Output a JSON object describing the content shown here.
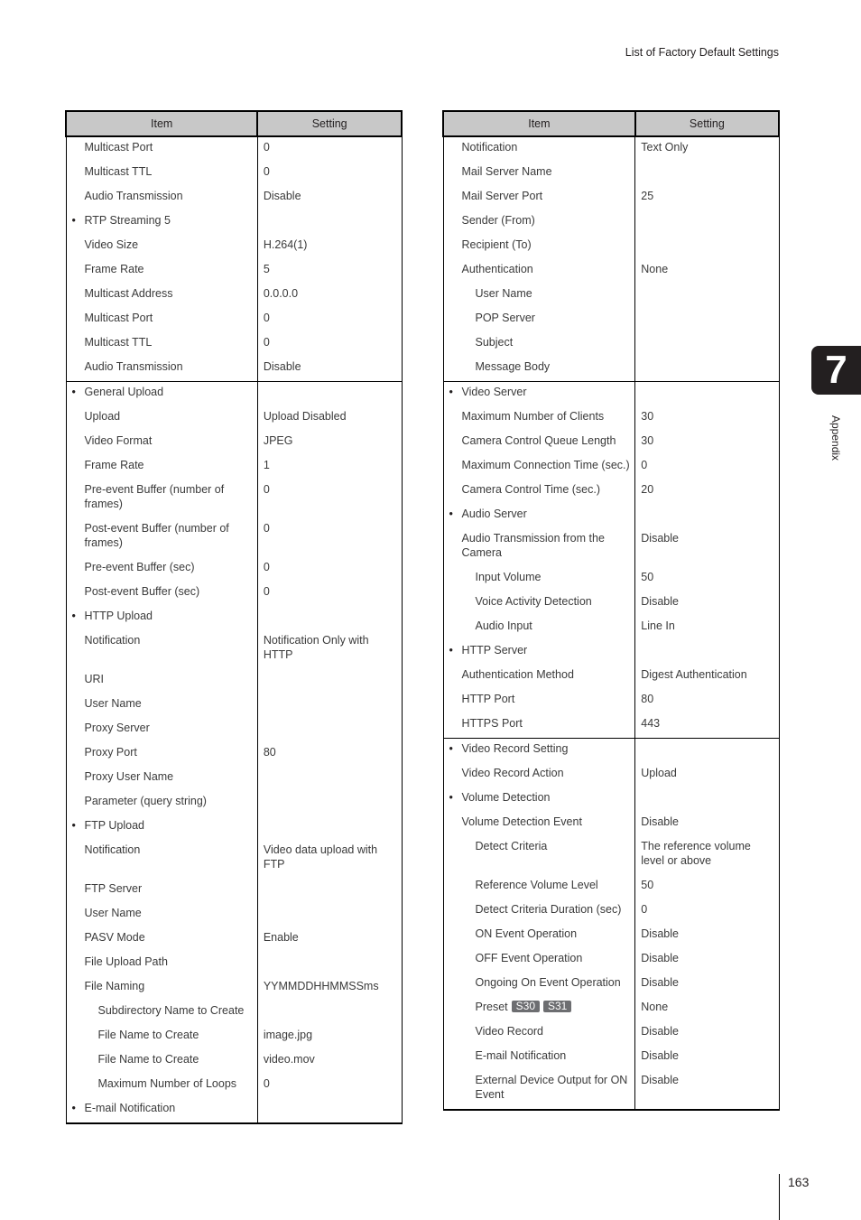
{
  "running_head": "List of Factory Default Settings",
  "chapter": {
    "number": "7",
    "label": "Appendix"
  },
  "page_number": "163",
  "headers": {
    "item": "Item",
    "setting": "Setting"
  },
  "left_table": {
    "groups": [
      {
        "rows": [
          {
            "item": "Multicast Port",
            "setting": "0",
            "level": 1
          },
          {
            "item": "Multicast TTL",
            "setting": "0",
            "level": 1
          },
          {
            "item": "Audio Transmission",
            "setting": "Disable",
            "level": 1
          },
          {
            "item": "RTP Streaming 5",
            "setting": "",
            "level": 0,
            "bullet": true
          },
          {
            "item": "Video Size",
            "setting": "H.264(1)",
            "level": 1
          },
          {
            "item": "Frame Rate",
            "setting": "5",
            "level": 1
          },
          {
            "item": "Multicast Address",
            "setting": "0.0.0.0",
            "level": 1
          },
          {
            "item": "Multicast Port",
            "setting": "0",
            "level": 1
          },
          {
            "item": "Multicast TTL",
            "setting": "0",
            "level": 1
          },
          {
            "item": "Audio Transmission",
            "setting": "Disable",
            "level": 1
          }
        ]
      },
      {
        "rows": [
          {
            "item": "General Upload",
            "setting": "",
            "level": 0,
            "bullet": true
          },
          {
            "item": "Upload",
            "setting": "Upload Disabled",
            "level": 1
          },
          {
            "item": "Video Format",
            "setting": "JPEG",
            "level": 1
          },
          {
            "item": "Frame Rate",
            "setting": "1",
            "level": 1
          },
          {
            "item": "Pre-event Buffer (number of frames)",
            "setting": "0",
            "level": 1
          },
          {
            "item": "Post-event Buffer (number of frames)",
            "setting": "0",
            "level": 1
          },
          {
            "item": "Pre-event Buffer (sec)",
            "setting": "0",
            "level": 1
          },
          {
            "item": "Post-event Buffer (sec)",
            "setting": "0",
            "level": 1
          },
          {
            "item": "HTTP Upload",
            "setting": "",
            "level": 0,
            "bullet": true
          },
          {
            "item": "Notification",
            "setting": "Notification Only with HTTP",
            "level": 1
          },
          {
            "item": "URI",
            "setting": "",
            "level": 1
          },
          {
            "item": "User Name",
            "setting": "",
            "level": 1
          },
          {
            "item": "Proxy Server",
            "setting": "",
            "level": 1
          },
          {
            "item": "Proxy Port",
            "setting": "80",
            "level": 1
          },
          {
            "item": "Proxy User Name",
            "setting": "",
            "level": 1
          },
          {
            "item": "Parameter (query string)",
            "setting": "",
            "level": 1
          },
          {
            "item": "FTP Upload",
            "setting": "",
            "level": 0,
            "bullet": true
          },
          {
            "item": "Notification",
            "setting": "Video data upload with FTP",
            "level": 1
          },
          {
            "item": "FTP Server",
            "setting": "",
            "level": 1
          },
          {
            "item": "User Name",
            "setting": "",
            "level": 1
          },
          {
            "item": "PASV Mode",
            "setting": "Enable",
            "level": 1
          },
          {
            "item": "File Upload Path",
            "setting": "",
            "level": 1
          },
          {
            "item": "File Naming",
            "setting": "YYMMDDHHMMSSms",
            "level": 1
          },
          {
            "item": "Subdirectory Name to Create",
            "setting": "",
            "level": 2
          },
          {
            "item": "File Name to Create",
            "setting": "image.jpg",
            "level": 2
          },
          {
            "item": "File Name to Create",
            "setting": "video.mov",
            "level": 2
          },
          {
            "item": "Maximum Number of Loops",
            "setting": "0",
            "level": 2
          },
          {
            "item": "E-mail Notification",
            "setting": "",
            "level": 0,
            "bullet": true
          }
        ]
      }
    ]
  },
  "right_table": {
    "groups": [
      {
        "rows": [
          {
            "item": "Notification",
            "setting": "Text Only",
            "level": 1
          },
          {
            "item": "Mail Server Name",
            "setting": "",
            "level": 1
          },
          {
            "item": "Mail Server Port",
            "setting": "25",
            "level": 1
          },
          {
            "item": "Sender (From)",
            "setting": "",
            "level": 1
          },
          {
            "item": "Recipient (To)",
            "setting": "",
            "level": 1
          },
          {
            "item": "Authentication",
            "setting": "None",
            "level": 1
          },
          {
            "item": "User Name",
            "setting": "",
            "level": 2
          },
          {
            "item": "POP Server",
            "setting": "",
            "level": 2
          },
          {
            "item": "Subject",
            "setting": "",
            "level": 2
          },
          {
            "item": "Message Body",
            "setting": "",
            "level": 2
          }
        ]
      },
      {
        "rows": [
          {
            "item": "Video Server",
            "setting": "",
            "level": 0,
            "bullet": true
          },
          {
            "item": "Maximum Number of Clients",
            "setting": "30",
            "level": 1
          },
          {
            "item": "Camera Control Queue Length",
            "setting": "30",
            "level": 1
          },
          {
            "item": "Maximum Connection Time (sec.)",
            "setting": "0",
            "level": 1
          },
          {
            "item": "Camera Control Time (sec.)",
            "setting": "20",
            "level": 1
          },
          {
            "item": "Audio Server",
            "setting": "",
            "level": 0,
            "bullet": true
          },
          {
            "item": "Audio Transmission from the Camera",
            "setting": "Disable",
            "level": 1
          },
          {
            "item": "Input Volume",
            "setting": "50",
            "level": 2
          },
          {
            "item": "Voice Activity Detection",
            "setting": "Disable",
            "level": 2
          },
          {
            "item": "Audio Input",
            "setting": "Line In",
            "level": 2
          },
          {
            "item": "HTTP Server",
            "setting": "",
            "level": 0,
            "bullet": true
          },
          {
            "item": "Authentication Method",
            "setting": "Digest Authentication",
            "level": 1
          },
          {
            "item": "HTTP Port",
            "setting": "80",
            "level": 1
          },
          {
            "item": "HTTPS Port",
            "setting": "443",
            "level": 1
          }
        ]
      },
      {
        "rows": [
          {
            "item": "Video Record Setting",
            "setting": "",
            "level": 0,
            "bullet": true
          },
          {
            "item": "Video Record Action",
            "setting": "Upload",
            "level": 1
          },
          {
            "item": "Volume Detection",
            "setting": "",
            "level": 0,
            "bullet": true
          },
          {
            "item": "Volume Detection Event",
            "setting": "Disable",
            "level": 1
          },
          {
            "item": "Detect Criteria",
            "setting": "The reference volume level or above",
            "level": 2
          },
          {
            "item": "Reference Volume Level",
            "setting": "50",
            "level": 2
          },
          {
            "item": "Detect Criteria Duration (sec)",
            "setting": "0",
            "level": 2
          },
          {
            "item": "ON Event Operation",
            "setting": "Disable",
            "level": 2
          },
          {
            "item": "OFF Event Operation",
            "setting": "Disable",
            "level": 2
          },
          {
            "item": "Ongoing On Event Operation",
            "setting": "Disable",
            "level": 2
          },
          {
            "item": "Preset",
            "setting": "None",
            "level": 2,
            "badges": [
              "S30",
              "S31"
            ]
          },
          {
            "item": "Video Record",
            "setting": "Disable",
            "level": 2
          },
          {
            "item": "E-mail Notification",
            "setting": "Disable",
            "level": 2
          },
          {
            "item": "External Device Output for ON Event",
            "setting": "Disable",
            "level": 2
          }
        ]
      }
    ]
  }
}
